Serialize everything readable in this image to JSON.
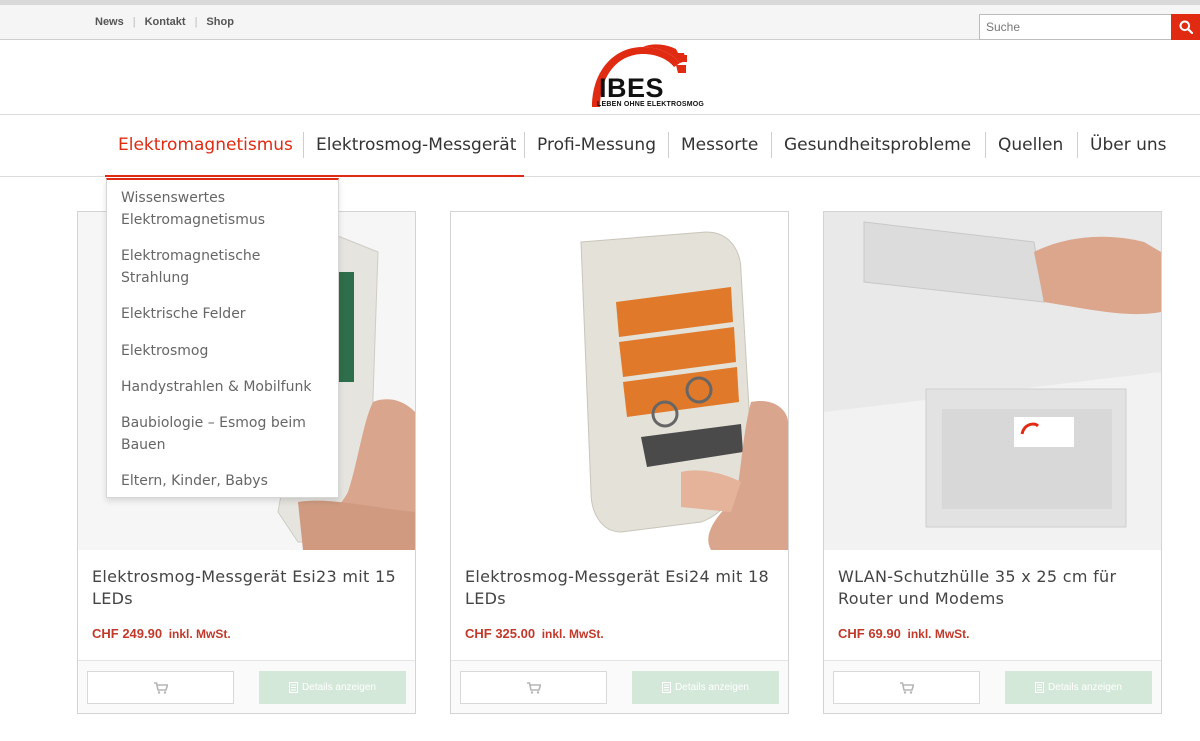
{
  "topbar": {
    "links": [
      "News",
      "Kontakt",
      "Shop"
    ],
    "search_placeholder": "Suche"
  },
  "logo": {
    "wordmark": "IBES",
    "tagline": "LEBEN OHNE ELEKTROSMOG"
  },
  "nav": {
    "items": [
      "Elektromagnetismus",
      "Elektrosmog-Messgerät",
      "Profi-Messung",
      "Messorte",
      "Gesundheitsprobleme",
      "Quellen",
      "Über uns"
    ],
    "active_index": 0
  },
  "dropdown": {
    "items": [
      "Wissenswertes Elektromagnetismus",
      "Elektromagnetische Strahlung",
      "Elektrische Felder",
      "Elektrosmog",
      "Handystrahlen & Mobilfunk",
      "Baubiologie – Esmog beim Bauen",
      "Eltern, Kinder, Babys"
    ]
  },
  "products": [
    {
      "title": "Elektrosmog-Messgerät Esi23 mit 15 LEDs",
      "price": "CHF 249.90",
      "vat": "inkl. MwSt.",
      "details_label": "Details anzeigen"
    },
    {
      "title": "Elektrosmog-Messgerät Esi24 mit 18 LEDs",
      "price": "CHF 325.00",
      "vat": "inkl. MwSt.",
      "details_label": "Details anzeigen"
    },
    {
      "title": "WLAN-Schutzhülle 35 x 25 cm für Router und Modems",
      "price": "CHF 69.90",
      "vat": "inkl. MwSt.",
      "details_label": "Details anzeigen"
    }
  ],
  "icons": {
    "search": "search-icon",
    "cart": "cart-icon",
    "details": "document-icon"
  },
  "colors": {
    "accent": "#e02a12",
    "price": "#c0392b",
    "details_button": "#d4e8d9"
  }
}
